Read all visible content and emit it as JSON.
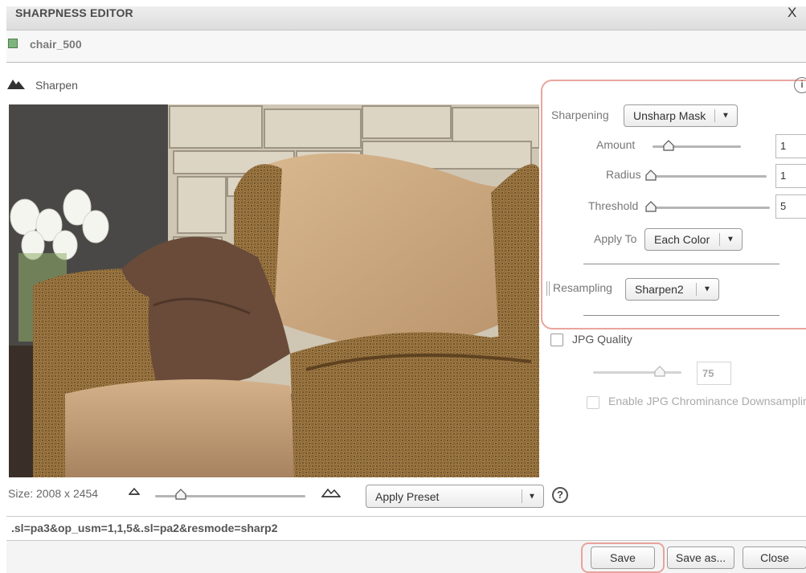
{
  "window": {
    "title": "SHARPNESS EDITOR",
    "close_glyph": "X"
  },
  "asset": {
    "name": "chair_500",
    "icon": "green-square-icon"
  },
  "section": {
    "label": "Sharpen",
    "icon": "mountains-icon"
  },
  "preview": {
    "size_label": "Size: 2008 x 2454",
    "zoom_level": 0.14,
    "preset_dropdown": {
      "label": "Apply Preset"
    }
  },
  "sharpening": {
    "label": "Sharpening",
    "mode": "Unsharp Mask",
    "amount": {
      "label": "Amount",
      "value": "1",
      "slider_fraction": 0.18
    },
    "radius": {
      "label": "Radius",
      "value": "1",
      "slider_fraction": 0.0
    },
    "threshold": {
      "label": "Threshold",
      "value": "5",
      "slider_fraction": 0.0
    },
    "apply_to": {
      "label": "Apply To",
      "value": "Each Color"
    },
    "resampling": {
      "label": "Resampling",
      "value": "Sharpen2"
    }
  },
  "jpg": {
    "checkbox_label": "JPG Quality",
    "checked": false,
    "quality": "75",
    "slider_fraction": 0.75,
    "chroma_label": "Enable JPG Chrominance Downsampling"
  },
  "url": ".sl=pa3&op_usm=1,1,5&.sl=pa2&resmode=sharp2",
  "buttons": {
    "save": "Save",
    "save_as": "Save as...",
    "close": "Close"
  },
  "colors": {
    "highlight": "#eaa59e",
    "accent_green": "#7fb47f"
  }
}
